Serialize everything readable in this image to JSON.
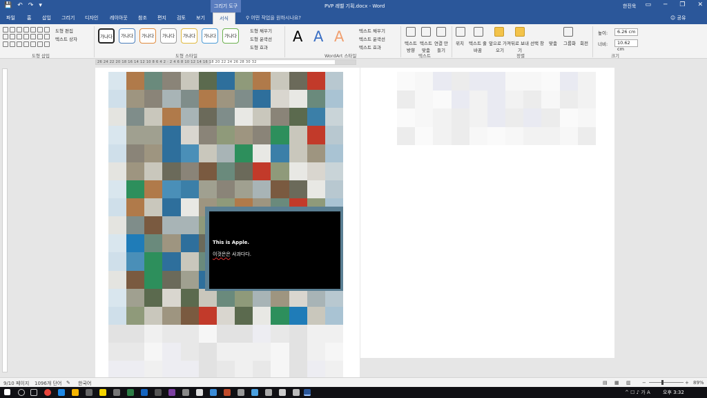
{
  "titlebar": {
    "qat": [
      "💾",
      "↶",
      "↷",
      "▾"
    ],
    "context_tools": "그리기 도구",
    "doc_title": "PVP 레벨 기획.docx - Word",
    "user": "한진욱",
    "window_buttons": [
      "▭",
      "─",
      "❐",
      "✕"
    ]
  },
  "tabs": [
    "파일",
    "홈",
    "삽입",
    "그리기",
    "디자인",
    "레이아웃",
    "참조",
    "편지",
    "검토",
    "보기",
    "서식"
  ],
  "tellme": "어떤 작업을 원하시나요?",
  "share": "공유",
  "ribbon": {
    "shape_insert": {
      "edit": "도형 편집",
      "textbox": "텍스트 상자",
      "label": "도형 삽입"
    },
    "shape_styles": {
      "preview": "가나다",
      "fill": "도형 채우기",
      "outline": "도형 윤곽선",
      "effects": "도형 효과",
      "label": "도형 스타일"
    },
    "wordart": {
      "letter": "A",
      "fill": "텍스트 채우기",
      "outline": "텍스트 윤곽선",
      "effects": "텍스트 효과",
      "label": "WordArt 스타일"
    },
    "text": {
      "direction": "텍스트 방향",
      "align": "텍스트 맞춤",
      "link": "연결 만들기",
      "label": "텍스트"
    },
    "arrange": {
      "position": "위치",
      "wrap": "텍스트 줄 바꿈",
      "forward": "앞으로 가져오기",
      "backward": "뒤로 보내기",
      "select": "선택 창",
      "align": "맞춤",
      "group": "그룹화",
      "rotate": "회전",
      "label": "정렬"
    },
    "size": {
      "height_label": "높이:",
      "height": "6.26 cm",
      "width_label": "너비:",
      "width": "10.62 cm",
      "label": "크기"
    }
  },
  "ruler_numbers": "26 24 22 20 18 16 14 12 10 8 6 4 2 · 2 4 6 8 10 12 14 16 18 20 22 24 26 28 30 32",
  "subtitle": {
    "english": "This is Apple.",
    "korean_a": "이것은은",
    "korean_b": " 사과다다."
  },
  "status": {
    "page": "9/10 페이지",
    "words": "1096개 단어",
    "lang": "한국어",
    "zoom": "89%"
  },
  "taskbar": {
    "time": "오후 3:32",
    "tray": "^ ☐ ♪ 가 A"
  },
  "colors": {
    "accent": "#2b579a",
    "ribbon": "#f3f3f3"
  }
}
